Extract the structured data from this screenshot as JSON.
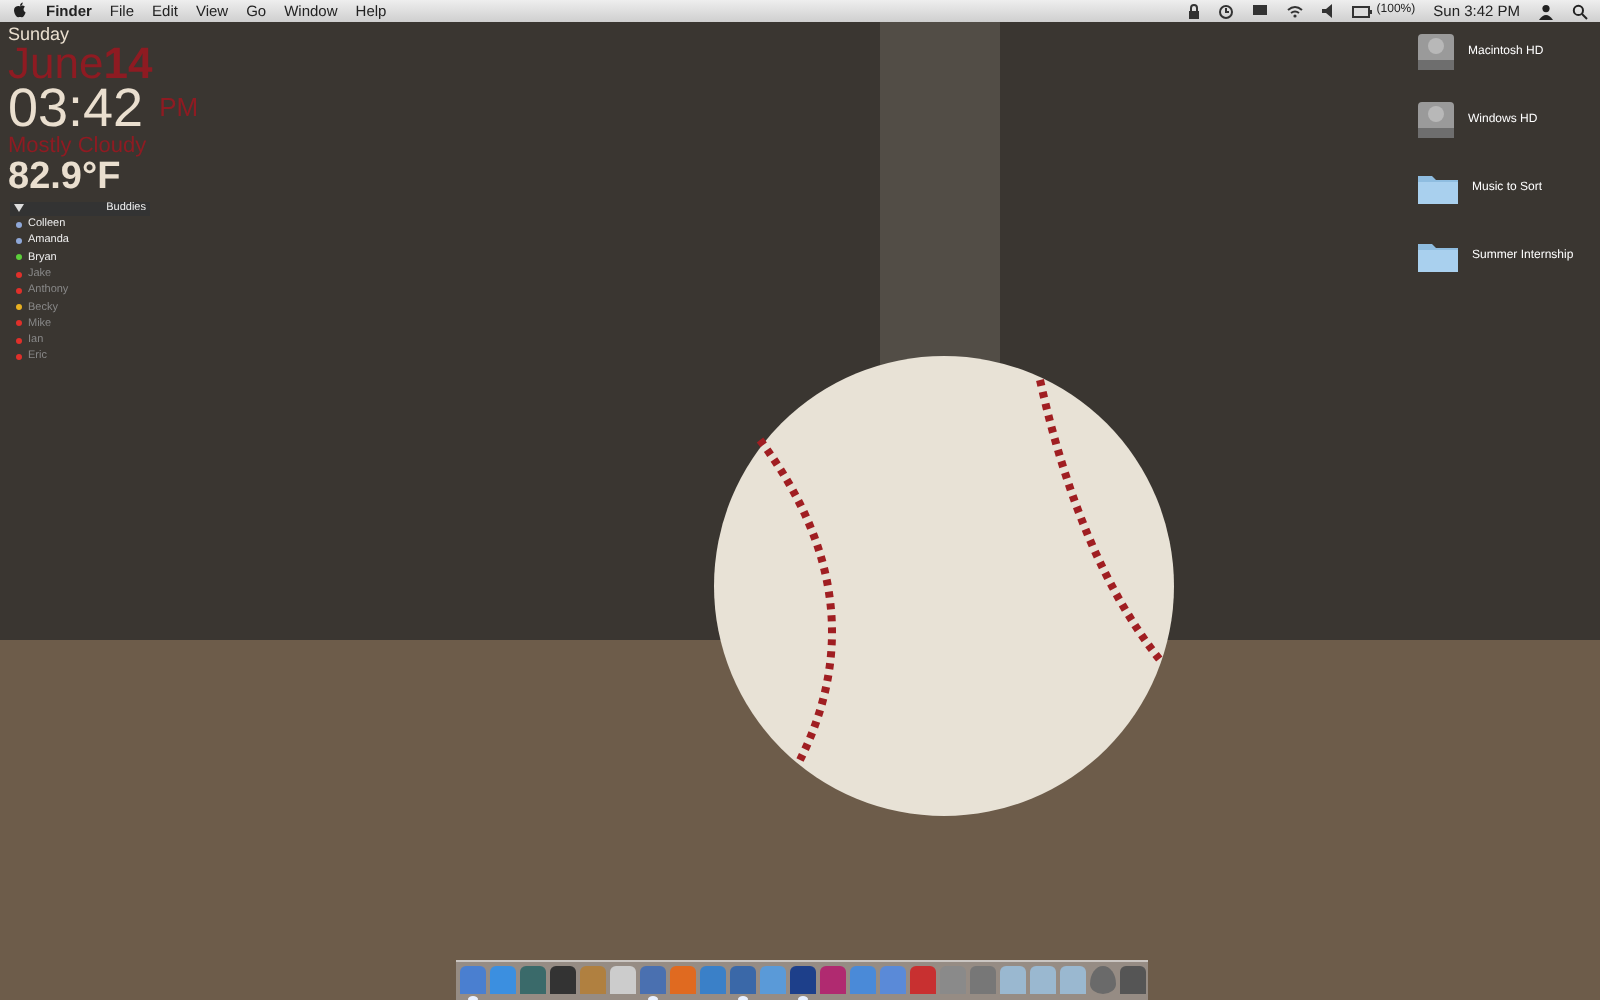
{
  "menu_bar": {
    "items": [
      "Finder",
      "File",
      "Edit",
      "View",
      "Go",
      "Window",
      "Help"
    ],
    "battery": "(100%)",
    "clock": "Sun 3:42 PM"
  },
  "widget": {
    "day": "Sunday",
    "month": "June",
    "date": "14",
    "time": "03:42",
    "ampm": "PM",
    "condition": "Mostly Cloudy",
    "temperature": "82.9°F"
  },
  "buddy_list": {
    "title": "Buddies",
    "expanded": true,
    "buddies": [
      {
        "name": "Colleen",
        "color": "#8fa8d8",
        "idle": false
      },
      {
        "name": "Amanda",
        "color": "#8fa8d8",
        "idle": false
      },
      {
        "name": "Bryan",
        "color": "#5ccf3a",
        "idle": false
      },
      {
        "name": "Jake",
        "color": "#e0302a",
        "idle": true
      },
      {
        "name": "Anthony",
        "color": "#e0302a",
        "idle": true
      },
      {
        "name": "Becky",
        "color": "#e8b020",
        "idle": true
      },
      {
        "name": "Mike",
        "color": "#e0302a",
        "idle": true
      },
      {
        "name": "Ian",
        "color": "#e0302a",
        "idle": true
      },
      {
        "name": "Eric",
        "color": "#e0302a",
        "idle": true
      }
    ]
  },
  "desktop_icons": [
    {
      "kind": "drive",
      "label": "Macintosh HD"
    },
    {
      "kind": "drive",
      "label": "Windows HD"
    },
    {
      "kind": "folder",
      "label": "Music to Sort"
    },
    {
      "kind": "folder",
      "label": "Summer Internship"
    }
  ],
  "dock": [
    {
      "kind": "app",
      "running": true
    },
    {
      "kind": "app",
      "running": false
    },
    {
      "kind": "app",
      "running": false
    },
    {
      "kind": "app",
      "running": false
    },
    {
      "kind": "app",
      "running": false
    },
    {
      "kind": "app",
      "running": false
    },
    {
      "kind": "app",
      "running": true
    },
    {
      "kind": "app",
      "running": false
    },
    {
      "kind": "app",
      "running": false
    },
    {
      "kind": "app",
      "running": true
    },
    {
      "kind": "app",
      "running": false
    },
    {
      "kind": "app",
      "running": true
    },
    {
      "kind": "app",
      "running": false
    },
    {
      "kind": "app",
      "running": false
    },
    {
      "kind": "app",
      "running": false
    },
    {
      "kind": "app",
      "running": false
    },
    {
      "kind": "app",
      "running": false
    },
    {
      "kind": "app",
      "running": false
    },
    {
      "kind": "folder",
      "running": false
    },
    {
      "kind": "folder",
      "running": false
    },
    {
      "kind": "folder",
      "running": false
    },
    {
      "kind": "avatar",
      "running": false
    },
    {
      "kind": "trash",
      "running": false
    }
  ]
}
